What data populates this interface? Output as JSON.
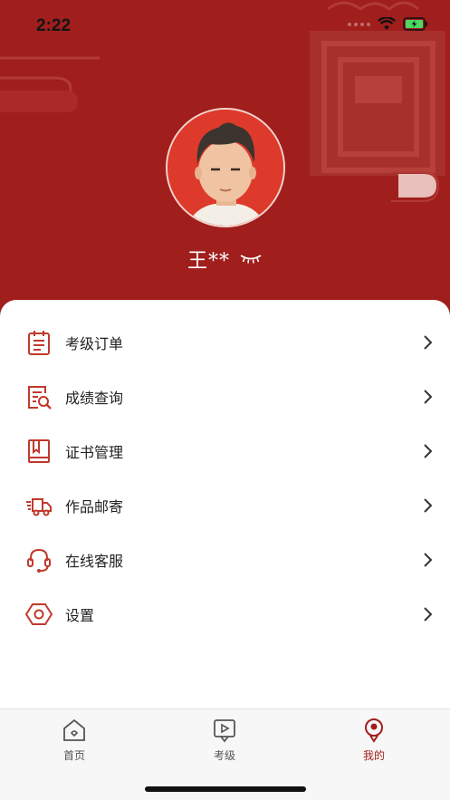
{
  "status_bar": {
    "time": "2:22"
  },
  "profile": {
    "user_name": "王**",
    "visibility_icon": "eye-closed-icon"
  },
  "menu": {
    "items": [
      {
        "label": "考级订单",
        "icon": "order-clipboard-icon"
      },
      {
        "label": "成绩查询",
        "icon": "score-search-icon"
      },
      {
        "label": "证书管理",
        "icon": "certificate-book-icon"
      },
      {
        "label": "作品邮寄",
        "icon": "delivery-truck-icon"
      },
      {
        "label": "在线客服",
        "icon": "headset-service-icon"
      },
      {
        "label": "设置",
        "icon": "settings-hexagon-icon"
      }
    ]
  },
  "tab_bar": {
    "tabs": [
      {
        "label": "首页",
        "icon": "home-icon",
        "active": false
      },
      {
        "label": "考级",
        "icon": "video-play-icon",
        "active": false
      },
      {
        "label": "我的",
        "icon": "profile-icon",
        "active": true
      }
    ]
  },
  "colors": {
    "brand_red": "#a01e1c",
    "accent_red": "#c0392b",
    "background": "#f7f7f7"
  }
}
